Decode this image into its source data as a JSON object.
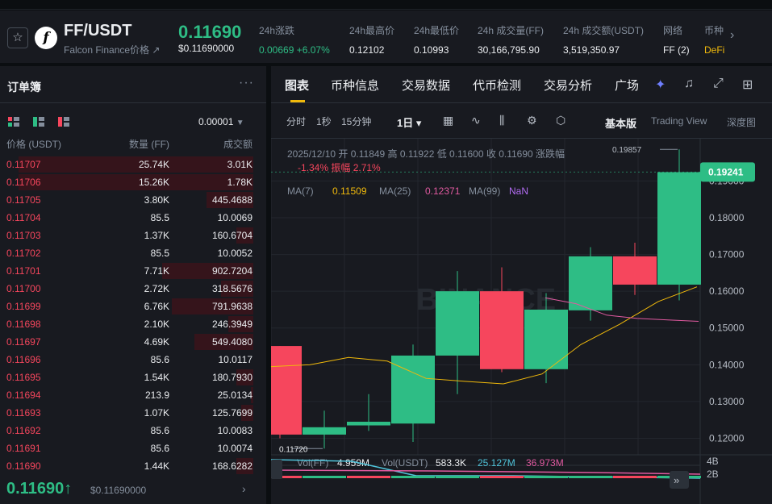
{
  "header": {
    "pair": "FF/USDT",
    "subtitle": "Falcon Finance价格 ↗",
    "logo_letter": "f",
    "price": "0.11690",
    "price_usd": "$0.11690000",
    "stats": [
      {
        "label": "24h涨跌",
        "value": "0.00669 +6.07%",
        "cls": "up"
      },
      {
        "label": "24h最高价",
        "value": "0.12102",
        "cls": ""
      },
      {
        "label": "24h最低价",
        "value": "0.10993",
        "cls": ""
      },
      {
        "label": "24h 成交量(FF)",
        "value": "30,166,795.90",
        "cls": ""
      },
      {
        "label": "24h 成交额(USDT)",
        "value": "3,519,350.97",
        "cls": ""
      },
      {
        "label": "网络",
        "value": "FF (2)",
        "cls": ""
      },
      {
        "label": "币种",
        "value": "DeFi",
        "cls": "gold"
      }
    ]
  },
  "orderbook": {
    "title": "订单簿",
    "precision": "0.00001",
    "col_price": "价格 (USDT)",
    "col_qty": "数量 (FF)",
    "col_total": "成交额",
    "asks": [
      {
        "price": "0.11707",
        "qty": "25.74K",
        "total": "3.01K",
        "depth": 0.95
      },
      {
        "price": "0.11706",
        "qty": "15.26K",
        "total": "1.78K",
        "depth": 0.95
      },
      {
        "price": "0.11705",
        "qty": "3.80K",
        "total": "445.4688",
        "depth": 0.19
      },
      {
        "price": "0.11704",
        "qty": "85.5",
        "total": "10.0069",
        "depth": 0.0
      },
      {
        "price": "0.11703",
        "qty": "1.37K",
        "total": "160.6704",
        "depth": 0.07
      },
      {
        "price": "0.11702",
        "qty": "85.5",
        "total": "10.0052",
        "depth": 0.0
      },
      {
        "price": "0.11701",
        "qty": "7.71K",
        "total": "902.7204",
        "depth": 0.37
      },
      {
        "price": "0.11700",
        "qty": "2.72K",
        "total": "318.5676",
        "depth": 0.13
      },
      {
        "price": "0.11699",
        "qty": "6.76K",
        "total": "791.9638",
        "depth": 0.33
      },
      {
        "price": "0.11698",
        "qty": "2.10K",
        "total": "246.3949",
        "depth": 0.1
      },
      {
        "price": "0.11697",
        "qty": "4.69K",
        "total": "549.4080",
        "depth": 0.24
      },
      {
        "price": "0.11696",
        "qty": "85.6",
        "total": "10.0117",
        "depth": 0.0
      },
      {
        "price": "0.11695",
        "qty": "1.54K",
        "total": "180.7930",
        "depth": 0.07
      },
      {
        "price": "0.11694",
        "qty": "213.9",
        "total": "25.0134",
        "depth": 0.01
      },
      {
        "price": "0.11693",
        "qty": "1.07K",
        "total": "125.7699",
        "depth": 0.05
      },
      {
        "price": "0.11692",
        "qty": "85.6",
        "total": "10.0083",
        "depth": 0.0
      },
      {
        "price": "0.11691",
        "qty": "85.6",
        "total": "10.0074",
        "depth": 0.0
      },
      {
        "price": "0.11690",
        "qty": "1.44K",
        "total": "168.6282",
        "depth": 0.07
      }
    ],
    "last_price": "0.11690↑",
    "last_price_usd": "$0.11690000"
  },
  "chart_panel": {
    "tabs": [
      "图表",
      "币种信息",
      "交易数据",
      "代币检测",
      "交易分析",
      "广场"
    ],
    "timeframes": [
      "分时",
      "1秒",
      "15分钟",
      "1日 ▾"
    ],
    "views": [
      "基本版",
      "Trading View",
      "深度图"
    ]
  },
  "chart_data": {
    "type": "candlestick",
    "info_line1": "2025/12/10  开  0.11849  高  0.11922  低  0.11600  收  0.11690  涨跌幅",
    "info_line2": "-1.34%  振幅  2.71%",
    "ma_line": {
      "ma7_label": "MA(7)",
      "ma7": "0.11509",
      "ma25_label": "MA(25)",
      "ma25": "0.12371",
      "ma99_label": "MA(99)",
      "ma99": "NaN"
    },
    "current_price_tag": "0.19241",
    "high_marker": "0.19857",
    "low_marker": "0.11720",
    "y_ticks": [
      "0.19000",
      "0.18000",
      "0.17000",
      "0.16000",
      "0.15000",
      "0.14000",
      "0.13000",
      "0.12000"
    ],
    "y_tick_values": [
      0.19,
      0.18,
      0.17,
      0.16,
      0.15,
      0.14,
      0.13,
      0.12
    ],
    "ylim": [
      0.1155,
      0.2015
    ],
    "candles": [
      {
        "o": 0.1451,
        "h": 0.143,
        "l": 0.12,
        "c": 0.121
      },
      {
        "o": 0.121,
        "h": 0.1275,
        "l": 0.1172,
        "c": 0.123
      },
      {
        "o": 0.1235,
        "h": 0.132,
        "l": 0.122,
        "c": 0.1245
      },
      {
        "o": 0.124,
        "h": 0.1455,
        "l": 0.119,
        "c": 0.1425
      },
      {
        "o": 0.1425,
        "h": 0.1655,
        "l": 0.132,
        "c": 0.16
      },
      {
        "o": 0.16,
        "h": 0.1665,
        "l": 0.138,
        "c": 0.1388
      },
      {
        "o": 0.1388,
        "h": 0.1595,
        "l": 0.135,
        "c": 0.155
      },
      {
        "o": 0.1548,
        "h": 0.172,
        "l": 0.152,
        "c": 0.1695
      },
      {
        "o": 0.1695,
        "h": 0.1732,
        "l": 0.159,
        "c": 0.1618
      },
      {
        "o": 0.1618,
        "h": 0.1986,
        "l": 0.1575,
        "c": 0.1924
      }
    ],
    "ma7_values": [
      0.1395,
      0.14,
      0.142,
      0.141,
      0.1363,
      0.1355,
      0.1348,
      0.1375,
      0.1455,
      0.151,
      0.1572,
      0.1612
    ],
    "ma25_values": [
      0.1582,
      0.1566,
      0.1535,
      0.1526,
      0.1522,
      0.1518
    ],
    "volume": {
      "label": "Vol(FF)",
      "vol_ff": "4.959M",
      "label2": "Vol(USDT)",
      "vol_usdt": "583.3K",
      "ma1": "25.127M",
      "ma2": "36.973M",
      "y_ticks": [
        "4B",
        "2B"
      ]
    },
    "watermark": "BINANCE"
  }
}
